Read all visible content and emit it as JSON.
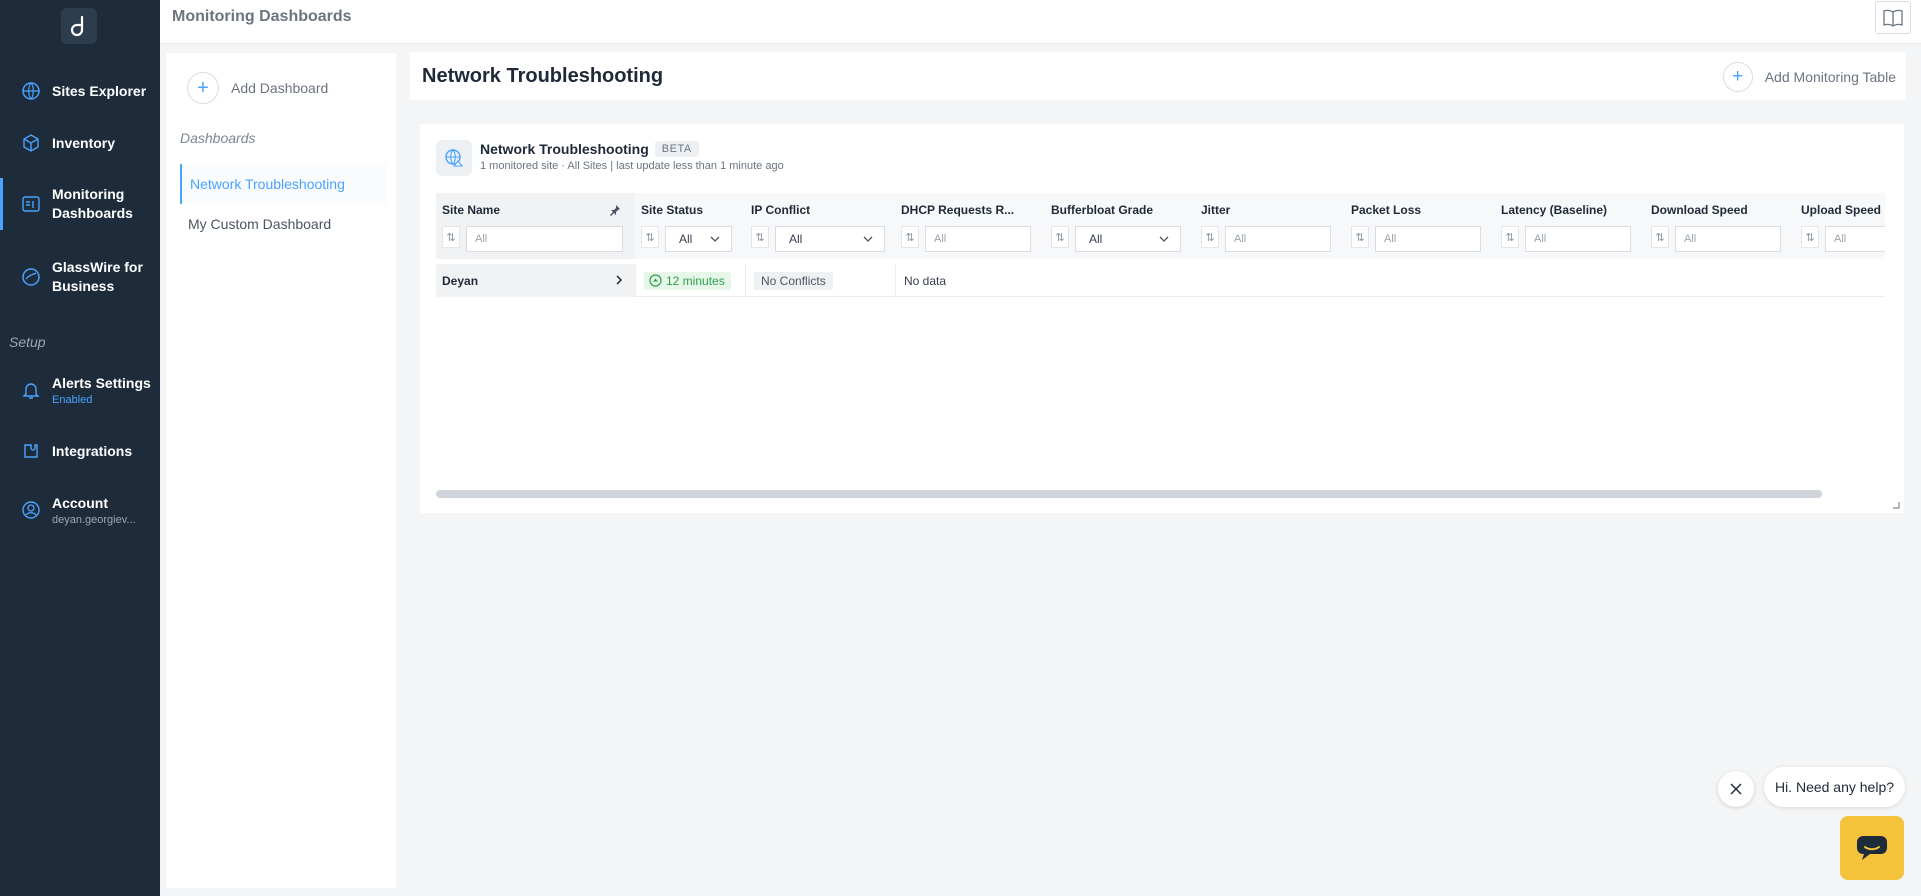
{
  "app": {
    "page_title": "Monitoring Dashboards"
  },
  "sidebar": {
    "items": [
      {
        "label": "Sites Explorer"
      },
      {
        "label": "Inventory"
      },
      {
        "label": "Monitoring",
        "label2": "Dashboards"
      },
      {
        "label": "GlassWire for",
        "label2": "Business"
      },
      {
        "label": "Alerts Settings",
        "sub": "Enabled"
      },
      {
        "label": "Integrations"
      },
      {
        "label": "Account",
        "sub": "deyan.georgiev..."
      }
    ],
    "setup_label": "Setup"
  },
  "dashboards": {
    "add_label": "Add Dashboard",
    "heading": "Dashboards",
    "items": [
      {
        "label": "Network Troubleshooting",
        "active": true
      },
      {
        "label": "My Custom Dashboard",
        "active": false
      }
    ]
  },
  "main": {
    "title": "Network Troubleshooting",
    "add_table_label": "Add Monitoring Table"
  },
  "table_card": {
    "title": "Network Troubleshooting",
    "badge": "BETA",
    "subtitle": "1 monitored site · All Sites | last update less than 1 minute ago",
    "columns": [
      {
        "label": "Site Name",
        "filter": "All",
        "filter_type": "input"
      },
      {
        "label": "Site Status",
        "filter": "All",
        "filter_type": "select"
      },
      {
        "label": "IP Conflict",
        "filter": "All",
        "filter_type": "select"
      },
      {
        "label": "DHCP Requests R...",
        "filter": "All",
        "filter_type": "input"
      },
      {
        "label": "Bufferbloat Grade",
        "filter": "All",
        "filter_type": "select"
      },
      {
        "label": "Jitter",
        "filter": "All",
        "filter_type": "input"
      },
      {
        "label": "Packet Loss",
        "filter": "All",
        "filter_type": "input"
      },
      {
        "label": "Latency (Baseline)",
        "filter": "All",
        "filter_type": "input"
      },
      {
        "label": "Download Speed",
        "filter": "All",
        "filter_type": "input"
      },
      {
        "label": "Upload Speed",
        "filter": "All",
        "filter_type": "input"
      }
    ],
    "rows": [
      {
        "site": "Deyan",
        "status": "12 minutes",
        "ip_conflict": "No Conflicts",
        "dhcp": "No data"
      }
    ]
  },
  "help": {
    "bubble_text": "Hi. Need any help?"
  },
  "colors": {
    "accent": "#4aa3ff",
    "sidebar_bg": "#1d2b3a",
    "status_green": "#2e9e48",
    "launcher": "#f5c33b"
  },
  "icons": [
    "logo-icon",
    "globe-icon",
    "cube-icon",
    "dashboard-icon",
    "glasswire-icon",
    "bell-icon",
    "puzzle-icon",
    "user-icon",
    "book-icon",
    "plus-icon",
    "sort-icon",
    "pin-icon",
    "chevron-down-icon",
    "chevron-right-icon",
    "close-icon",
    "chat-icon"
  ]
}
